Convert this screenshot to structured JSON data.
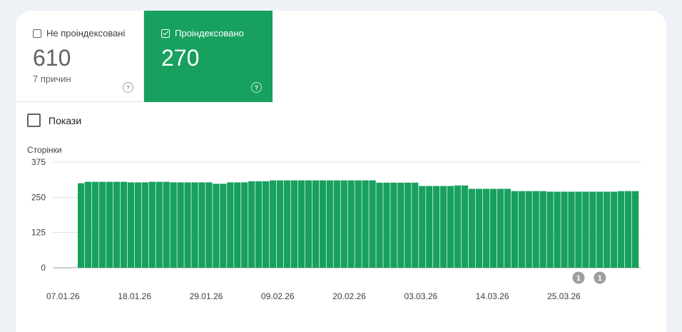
{
  "tiles": {
    "not_indexed": {
      "label": "Не проіндексовані",
      "value": "610",
      "sub": "7 причин",
      "help": "?"
    },
    "indexed": {
      "label": "Проіндексовано",
      "value": "270",
      "help": "?"
    }
  },
  "show": {
    "label": "Покази"
  },
  "colors": {
    "accent": "#17a05e",
    "grid": "#e0e0e0"
  },
  "chart_data": {
    "type": "bar",
    "ylabel": "Сторінки",
    "ylim": [
      0,
      375
    ],
    "yticks": [
      "375",
      "250",
      "125",
      "0"
    ],
    "ytick_values": [
      375,
      250,
      125,
      0
    ],
    "xticks": [
      "07.01.26",
      "18.01.26",
      "29.01.26",
      "09.02.26",
      "20.02.26",
      "03.03.26",
      "14.03.26",
      "25.03.26"
    ],
    "annotations": [
      {
        "label": "1",
        "bar_index": 70
      },
      {
        "label": "1",
        "bar_index": 73
      }
    ],
    "values": [
      300,
      305,
      305,
      305,
      305,
      305,
      305,
      303,
      303,
      303,
      305,
      305,
      305,
      303,
      303,
      303,
      303,
      303,
      303,
      298,
      298,
      303,
      303,
      303,
      307,
      307,
      307,
      310,
      310,
      310,
      310,
      310,
      310,
      310,
      310,
      310,
      310,
      310,
      310,
      310,
      310,
      310,
      302,
      302,
      302,
      302,
      302,
      302,
      290,
      290,
      290,
      290,
      290,
      292,
      292,
      280,
      280,
      280,
      280,
      280,
      280,
      272,
      272,
      272,
      272,
      272,
      270,
      270,
      270,
      270,
      270,
      270,
      270,
      270,
      270,
      270,
      272,
      272,
      272
    ]
  }
}
